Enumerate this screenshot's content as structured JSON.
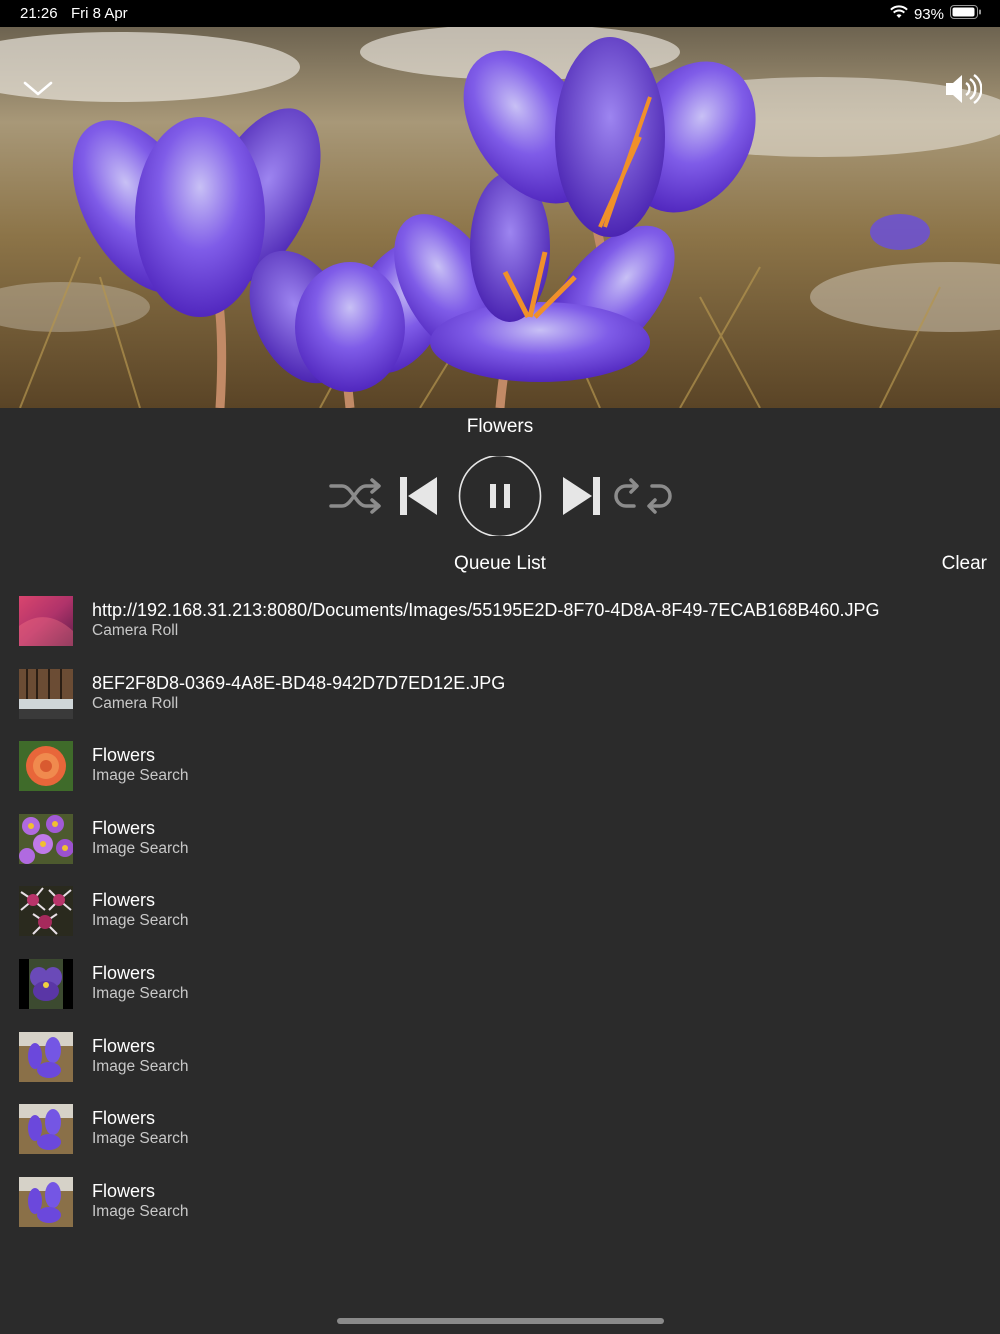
{
  "status_bar": {
    "time": "21:26",
    "date": "Fri 8 Apr",
    "battery": "93%",
    "icons": [
      "wifi-icon",
      "battery-icon"
    ]
  },
  "hero": {
    "icons": [
      "chevron-down-icon",
      "speaker-icon"
    ]
  },
  "player": {
    "title": "Flowers",
    "controls": [
      "shuffle-icon",
      "previous-icon",
      "pause-icon",
      "next-icon",
      "repeat-icon"
    ]
  },
  "queue": {
    "title": "Queue List",
    "clear_label": "Clear",
    "items": [
      {
        "title": "http://192.168.31.213:8080/Documents/Images/55195E2D-8F70-4D8A-8F49-7ECAB168B460.JPG",
        "source": "Camera Roll"
      },
      {
        "title": "8EF2F8D8-0369-4A8E-BD48-942D7D7ED12E.JPG",
        "source": "Camera Roll"
      },
      {
        "title": "Flowers",
        "source": "Image Search"
      },
      {
        "title": "Flowers",
        "source": "Image Search"
      },
      {
        "title": "Flowers",
        "source": "Image Search"
      },
      {
        "title": "Flowers",
        "source": "Image Search"
      },
      {
        "title": "Flowers",
        "source": "Image Search"
      },
      {
        "title": "Flowers",
        "source": "Image Search"
      },
      {
        "title": "Flowers",
        "source": "Image Search"
      }
    ]
  },
  "colors": {
    "background": "#2b2b2b",
    "status_bar": "#000000",
    "control_active": "#e6e6e6",
    "control_inactive": "#8c8c8c",
    "flower_purple": "#6a3fd8"
  }
}
